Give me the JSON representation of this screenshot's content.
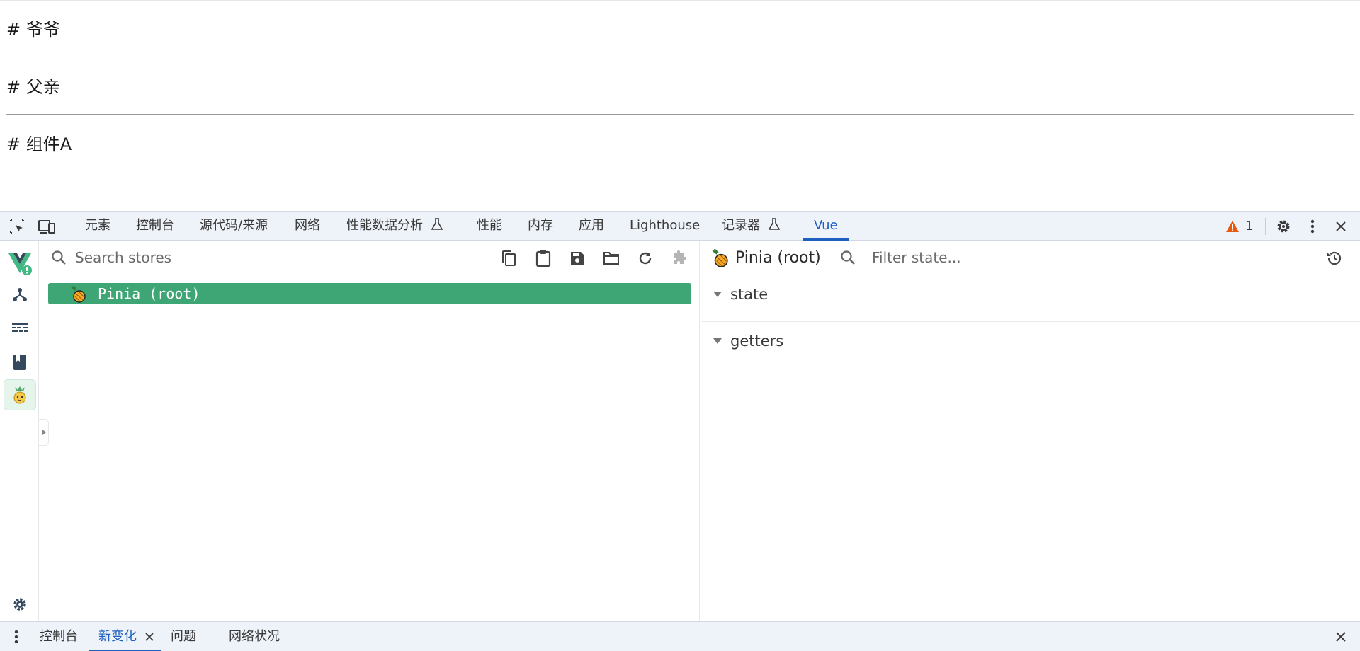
{
  "page": {
    "headings": [
      "# 爷爷",
      "# 父亲",
      "# 组件A"
    ]
  },
  "devtools": {
    "tabs": [
      {
        "label": "元素"
      },
      {
        "label": "控制台"
      },
      {
        "label": "源代码/来源"
      },
      {
        "label": "网络"
      },
      {
        "label": "性能数据分析"
      },
      {
        "label": "性能"
      },
      {
        "label": "内存"
      },
      {
        "label": "应用"
      },
      {
        "label": "Lighthouse"
      },
      {
        "label": "记录器"
      },
      {
        "label": "Vue"
      }
    ],
    "active_tab": "Vue",
    "warning_count": "1",
    "icons": [
      "inspect-icon",
      "device-toggle-icon",
      "flask-icon",
      "warning-icon",
      "gear-icon",
      "kebab-menu-icon",
      "close-icon"
    ]
  },
  "vue": {
    "nav_icons": [
      "vue-logo-icon",
      "component-tree-icon",
      "timeline-icon",
      "book-icon",
      "pinia-icon",
      "settings-icon"
    ],
    "stores": {
      "search_placeholder": "Search stores",
      "tool_icons": [
        "copy-icon",
        "clipboard-icon",
        "save-icon",
        "folder-icon",
        "refresh-icon",
        "plugin-icon"
      ],
      "items": [
        {
          "name": "Pinia (root)",
          "selected": true
        }
      ]
    },
    "state": {
      "title": "Pinia (root)",
      "filter_placeholder": "Filter state...",
      "sections": [
        "state",
        "getters"
      ]
    }
  },
  "drawer": {
    "tabs": [
      {
        "label": "控制台"
      },
      {
        "label": "新变化"
      },
      {
        "label": "问题"
      },
      {
        "label": "网络状况"
      }
    ],
    "active_tab": "新变化"
  },
  "colors": {
    "accent": "#1f5fbf",
    "store_selected": "#3ea574",
    "vue_green": "#42b883",
    "warning": "#e8590c"
  }
}
